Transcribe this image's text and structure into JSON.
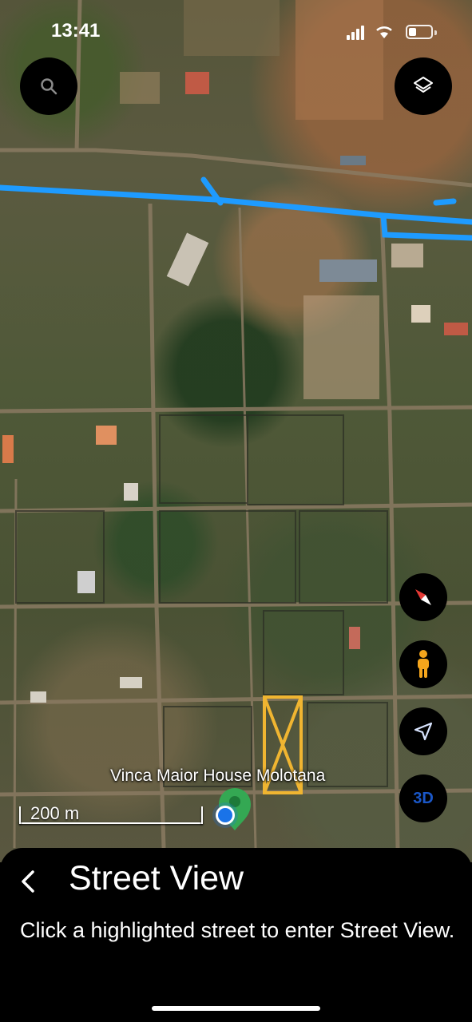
{
  "status_bar": {
    "time": "13:41"
  },
  "map": {
    "place_label": "Vinca Maior House Molotana",
    "scale_label": "200 m"
  },
  "controls": {
    "three_d_label": "3D"
  },
  "street_view_sheet": {
    "title": "Street View",
    "instruction": "Click a highlighted street to enter Street View."
  },
  "colors": {
    "street_highlight": "#1e9bff",
    "marker_green": "#34a853",
    "location_blue": "#1a73e8",
    "pegman": "#f4a51c",
    "sheet_bg": "#000000"
  }
}
